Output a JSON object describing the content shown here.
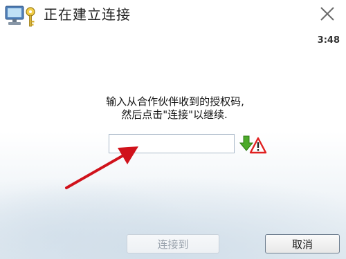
{
  "window": {
    "title": "正在建立连接",
    "timer": "3:48"
  },
  "instruction": {
    "line1": "输入从合作伙伴收到的授权码,",
    "line2": "然后点击\"连接\"以继续."
  },
  "auth_input": {
    "value": ""
  },
  "buttons": {
    "connect_label": "连接到",
    "cancel_label": "取消"
  },
  "icons": {
    "app": "computer-key-icon",
    "close": "close-icon",
    "status": "download-warning-icon",
    "pointer": "red-arrow-icon"
  },
  "colors": {
    "arrow": "#d0121b",
    "warning": "#e02020",
    "download": "#4caa2a"
  }
}
